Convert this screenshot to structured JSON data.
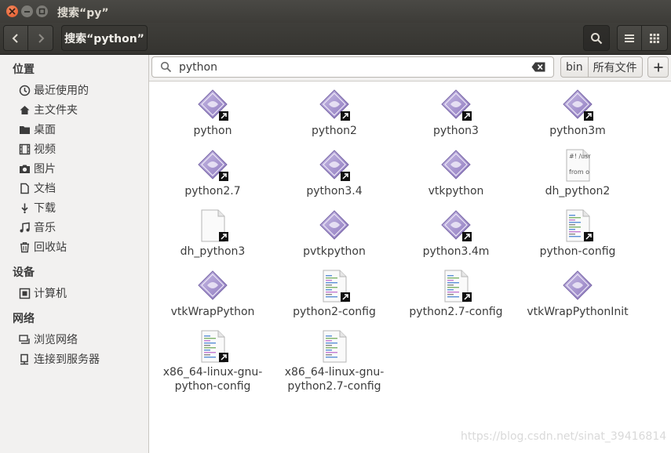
{
  "window": {
    "title": "搜索“py”"
  },
  "header": {
    "path_label": "搜索“python”"
  },
  "sidebar": {
    "sections": [
      {
        "heading": "位置",
        "items": [
          {
            "label": "最近使用的",
            "icon": "clock-icon"
          },
          {
            "label": "主文件夹",
            "icon": "home-icon"
          },
          {
            "label": "桌面",
            "icon": "desktop-folder-icon"
          },
          {
            "label": "视频",
            "icon": "video-icon"
          },
          {
            "label": "图片",
            "icon": "camera-icon"
          },
          {
            "label": "文档",
            "icon": "document-icon"
          },
          {
            "label": "下载",
            "icon": "download-icon"
          },
          {
            "label": "音乐",
            "icon": "music-icon"
          },
          {
            "label": "回收站",
            "icon": "trash-icon"
          }
        ]
      },
      {
        "heading": "设备",
        "items": [
          {
            "label": "计算机",
            "icon": "computer-icon"
          }
        ]
      },
      {
        "heading": "网络",
        "items": [
          {
            "label": "浏览网络",
            "icon": "network-icon"
          },
          {
            "label": "连接到服务器",
            "icon": "server-icon"
          }
        ]
      }
    ]
  },
  "search": {
    "value": "python",
    "placeholder": ""
  },
  "locations": {
    "current": "bin",
    "all_files": "所有文件"
  },
  "files": [
    {
      "name": "python",
      "type": "executable",
      "link": true
    },
    {
      "name": "python2",
      "type": "executable",
      "link": true
    },
    {
      "name": "python3",
      "type": "executable",
      "link": true
    },
    {
      "name": "python3m",
      "type": "executable",
      "link": true
    },
    {
      "name": "python2.7",
      "type": "executable",
      "link": true
    },
    {
      "name": "python3.4",
      "type": "executable",
      "link": true
    },
    {
      "name": "vtkpython",
      "type": "executable",
      "link": false
    },
    {
      "name": "dh_python2",
      "type": "script",
      "link": false,
      "preview": [
        "#! /usr",
        "from o"
      ]
    },
    {
      "name": "dh_python3",
      "type": "blank",
      "link": true
    },
    {
      "name": "pvtkpython",
      "type": "executable",
      "link": false
    },
    {
      "name": "python3.4m",
      "type": "executable",
      "link": true
    },
    {
      "name": "python-config",
      "type": "config",
      "link": true
    },
    {
      "name": "vtkWrapPython",
      "type": "executable",
      "link": false
    },
    {
      "name": "python2-config",
      "type": "config",
      "link": true
    },
    {
      "name": "python2.7-config",
      "type": "config",
      "link": true
    },
    {
      "name": "vtkWrapPythonInit",
      "type": "executable",
      "link": false
    },
    {
      "name": "x86_64-linux-gnu-python-config",
      "type": "config",
      "link": true,
      "lines": [
        "x86_64-linux-gnu-",
        "python-config"
      ]
    },
    {
      "name": "x86_64-linux-gnu-python2.7-config",
      "type": "config",
      "link": false,
      "lines": [
        "x86_64-linux-gnu-",
        "python2.7-config"
      ]
    }
  ],
  "watermark": "https://blog.csdn.net/sinat_39416814",
  "colors": {
    "titlebar": "#3d3c38",
    "close_button": "#e4572a",
    "exec_icon": "#9b87c9",
    "selection": "#ffffff"
  }
}
